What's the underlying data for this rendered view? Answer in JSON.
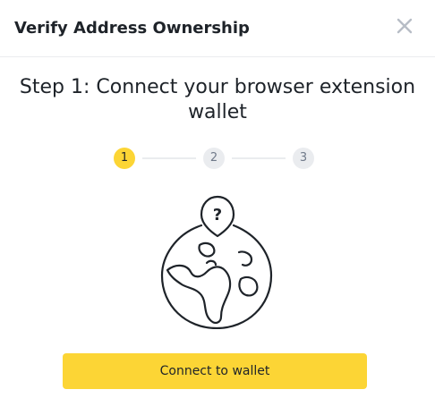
{
  "dialog": {
    "title": "Verify Address Ownership",
    "close_icon": "close-icon"
  },
  "step": {
    "heading": "Step 1: Connect your browser extension wallet",
    "current": 1,
    "steps": [
      "1",
      "2",
      "3"
    ]
  },
  "illustration": {
    "icon": "globe-question-icon",
    "pin_text": "?"
  },
  "actions": {
    "connect_label": "Connect to wallet"
  },
  "colors": {
    "accent": "#fcd535",
    "inactive": "#eaecef",
    "text": "#1e2329",
    "muted": "#707a8a"
  }
}
